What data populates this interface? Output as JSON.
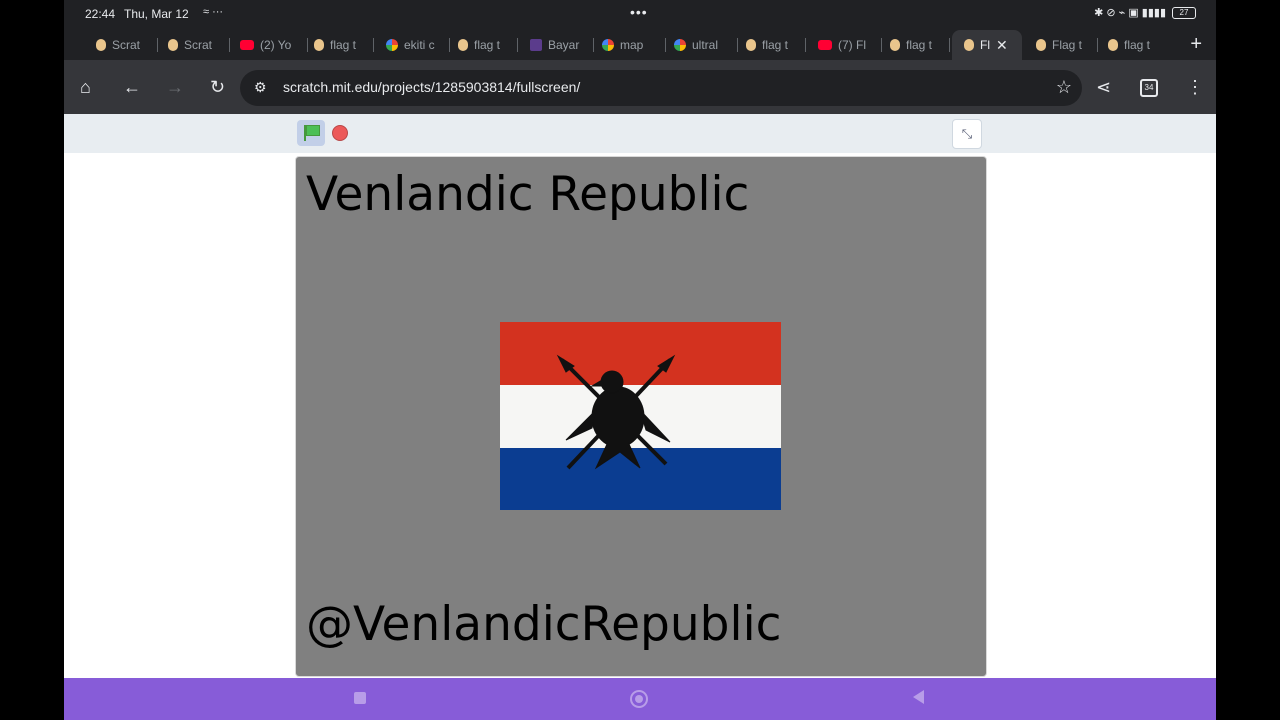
{
  "status": {
    "time": "22:44",
    "date": "Thu, Mar 12",
    "left_icons": "≈ ···",
    "center_dots": "•••",
    "right_icons": "✱ ⊘ ⌁ ▣ ▮▮▮▮",
    "battery": "27"
  },
  "tabs": [
    {
      "label": "Scrat",
      "icon": "scratch-cat-icon",
      "active": false
    },
    {
      "label": "Scrat",
      "icon": "scratch-cat-icon",
      "active": false
    },
    {
      "label": "(2) Yo",
      "icon": "youtube-icon",
      "active": false
    },
    {
      "label": "flag t",
      "icon": "scratch-cat-icon",
      "active": false
    },
    {
      "label": "ekiti c",
      "icon": "google-icon",
      "active": false
    },
    {
      "label": "flag t",
      "icon": "scratch-cat-icon",
      "active": false
    },
    {
      "label": "Bayar",
      "icon": "site-icon",
      "active": false
    },
    {
      "label": "map",
      "icon": "google-icon",
      "active": false
    },
    {
      "label": "ultral",
      "icon": "google-icon",
      "active": false
    },
    {
      "label": "flag t",
      "icon": "scratch-cat-icon",
      "active": false
    },
    {
      "label": "(7) Fl",
      "icon": "youtube-icon",
      "active": false
    },
    {
      "label": "flag t",
      "icon": "scratch-cat-icon",
      "active": false
    },
    {
      "label": "Fl",
      "icon": "scratch-cat-icon",
      "active": true
    },
    {
      "label": "Flag t",
      "icon": "scratch-cat-icon",
      "active": false
    },
    {
      "label": "flag t",
      "icon": "scratch-cat-icon",
      "active": false
    }
  ],
  "toolbar": {
    "url": "scratch.mit.edu/projects/1285903814/fullscreen/",
    "tab_count": "34"
  },
  "stage": {
    "title": "Venlandic Republic",
    "handle": "@VenlandicRepublic",
    "flag_colors": {
      "top": "#d3321f",
      "middle": "#f6f6f4",
      "bottom": "#0b3d91",
      "emblem": "#111111"
    }
  },
  "colors": {
    "navbar": "#875cd8",
    "stage_bg": "#808080",
    "menubar": "#e8edf1"
  }
}
